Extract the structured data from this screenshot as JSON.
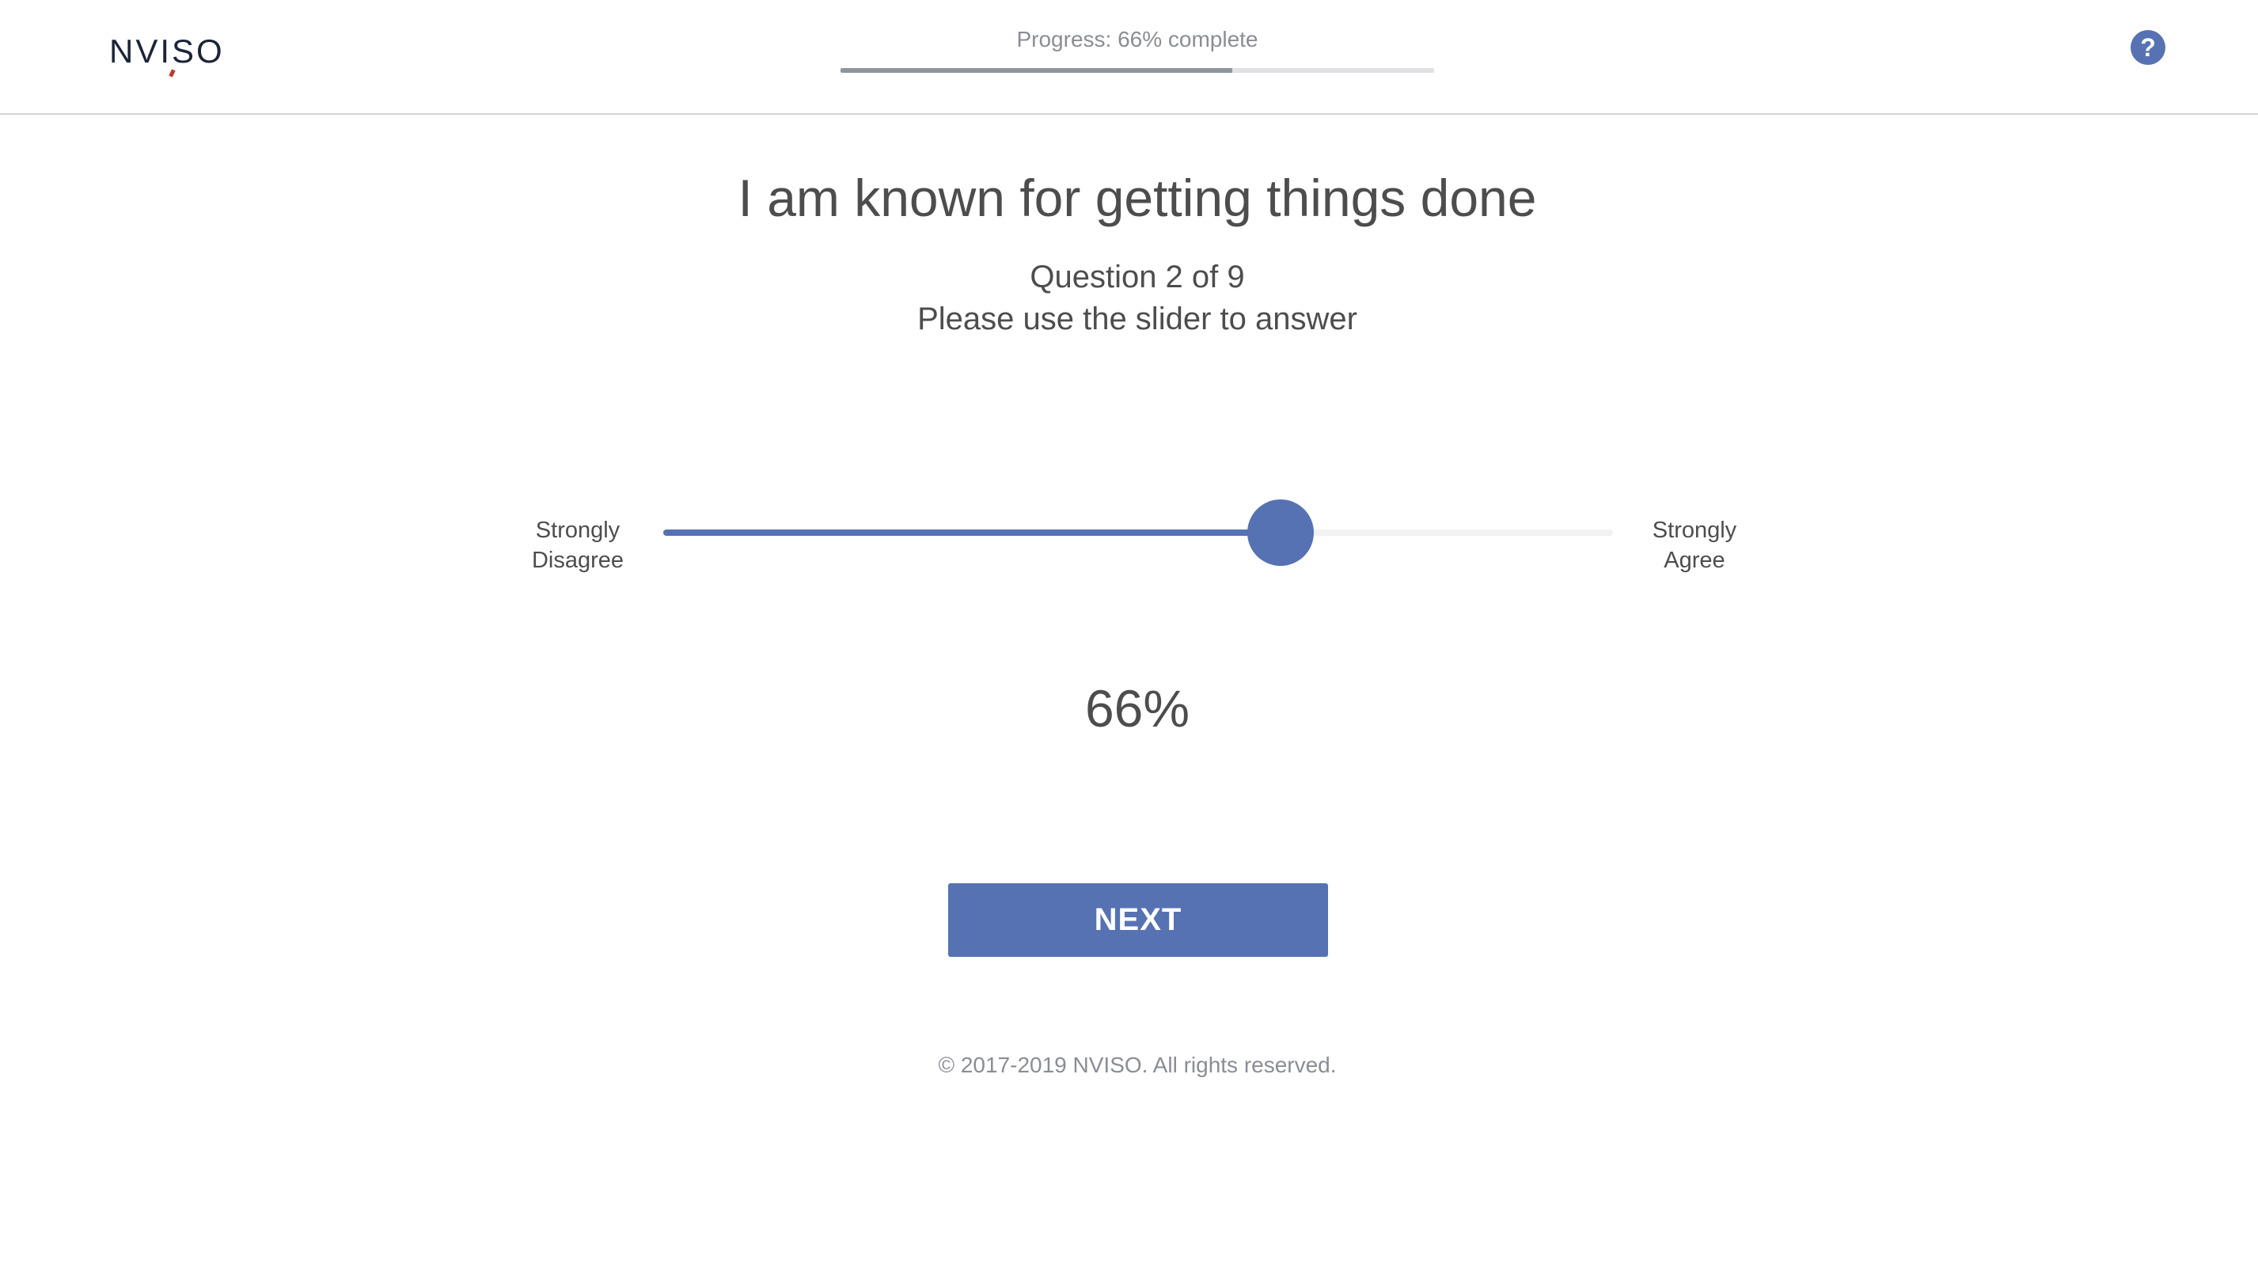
{
  "header": {
    "logo_text": "NVISO",
    "progress_label": "Progress: 66% complete",
    "progress_fraction": 0.66,
    "help_icon": "question-circle-icon"
  },
  "question": {
    "title": "I am known for getting things done",
    "counter": "Question 2 of 9",
    "instruction": "Please use the slider to answer"
  },
  "slider": {
    "min_label_line1": "Strongly",
    "min_label_line2": "Disagree",
    "max_label_line1": "Strongly",
    "max_label_line2": "Agree",
    "value_fraction": 0.65,
    "value_text": "66%"
  },
  "actions": {
    "next_label": "NEXT"
  },
  "footer": {
    "copyright": "© 2017-2019 NVISO. All rights reserved."
  },
  "colors": {
    "accent": "#5672b3",
    "progress_fill": "#8e959d",
    "progress_track": "#dfe1e5",
    "text": "#4d4d4d",
    "muted_text": "#8a8d94"
  }
}
